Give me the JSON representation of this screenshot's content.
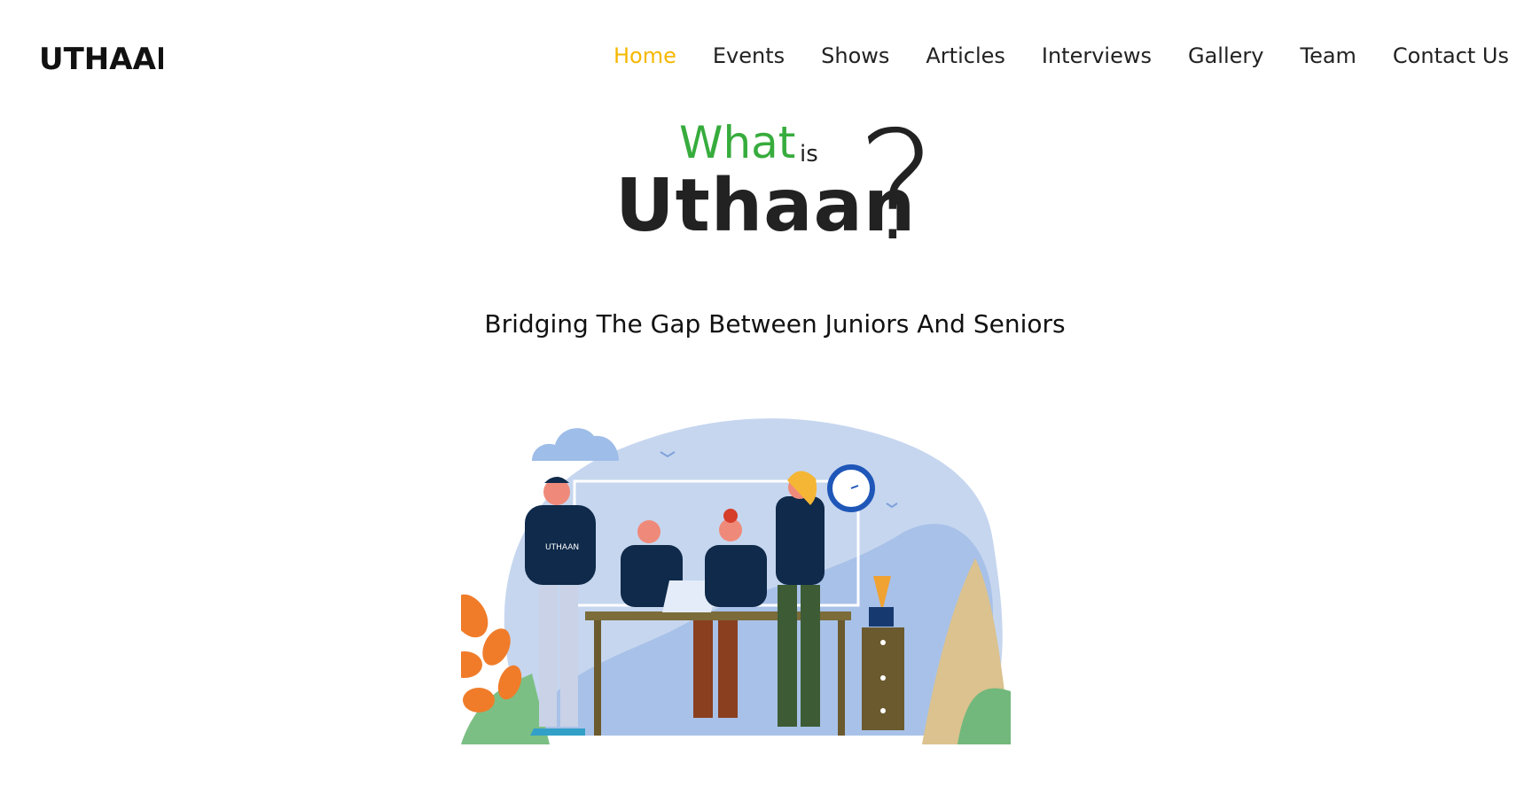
{
  "header": {
    "logo_text": "UTHAAN",
    "nav": [
      {
        "label": "Home",
        "active": true
      },
      {
        "label": "Events",
        "active": false
      },
      {
        "label": "Shows",
        "active": false
      },
      {
        "label": "Articles",
        "active": false
      },
      {
        "label": "Interviews",
        "active": false
      },
      {
        "label": "Gallery",
        "active": false
      },
      {
        "label": "Team",
        "active": false
      },
      {
        "label": "Contact Us",
        "active": false
      }
    ]
  },
  "hero": {
    "what": "What",
    "is": "is",
    "name": "Uthaan",
    "question_mark": "?",
    "subtitle": "Bridging The Gap Between Juniors And Seniors"
  },
  "colors": {
    "nav_active": "#f5b800",
    "what_green": "#37ac3d",
    "text_dark": "#222222",
    "shirt_navy": "#0f2a4a",
    "sky_blue": "#c6d6ef"
  },
  "illustration": {
    "icon": "team-illustration",
    "shirt_logo_text": "UTHAAN"
  }
}
